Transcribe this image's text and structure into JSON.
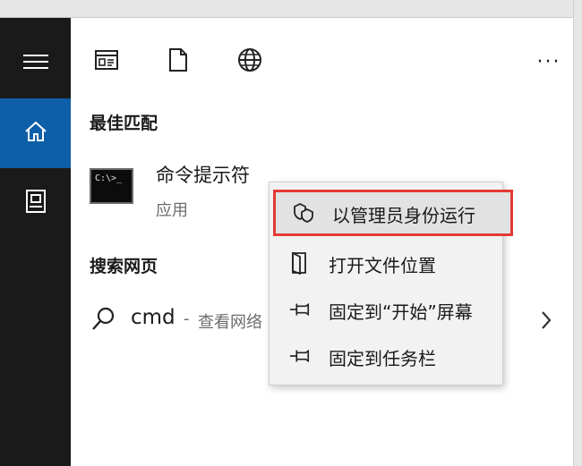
{
  "sidebar": {
    "items": [
      {
        "icon": "hamburger-menu-icon"
      },
      {
        "icon": "home-icon",
        "active": true
      },
      {
        "icon": "documents-icon"
      }
    ],
    "accent_color": "#0e5ea8"
  },
  "toolbar": {
    "icons": [
      "apps-icon",
      "document-icon",
      "web-globe-icon"
    ],
    "more_label": "···"
  },
  "best_match": {
    "heading": "最佳匹配",
    "title": "命令提示符",
    "subtitle": "应用",
    "icon_text": "C:\\>_"
  },
  "web": {
    "heading": "搜索网页",
    "query": "cmd",
    "separator": "-",
    "suffix": "查看网络"
  },
  "context_menu": {
    "items": [
      {
        "label": "以管理员身份运行",
        "icon": "shield-icon",
        "highlighted": true
      },
      {
        "label": "打开文件位置",
        "icon": "open-folder-icon"
      },
      {
        "label": "固定到“开始”屏幕",
        "icon": "pin-icon"
      },
      {
        "label": "固定到任务栏",
        "icon": "pin-icon"
      }
    ],
    "highlight_color": "#e53935"
  }
}
